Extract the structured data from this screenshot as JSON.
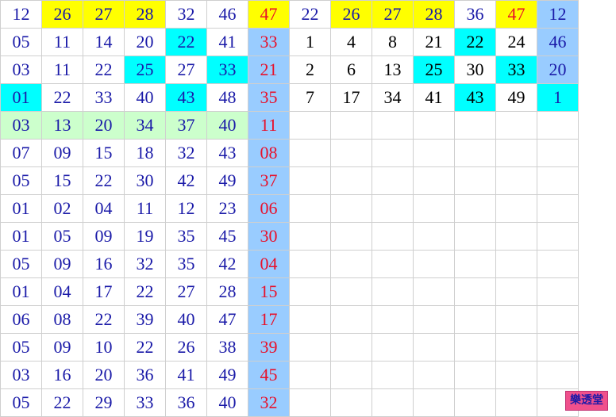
{
  "colors": {
    "yellow": "#ffff00",
    "cyan": "#00ffff",
    "light_blue": "#99ccff",
    "light_green": "#ccffcc",
    "blue_text": "#1a1aa8",
    "red_text": "#e8102a",
    "black_text": "#000000"
  },
  "left_rows": [
    {
      "cells": [
        {
          "v": "12"
        },
        {
          "v": "26",
          "bg": "yellow"
        },
        {
          "v": "27",
          "bg": "yellow"
        },
        {
          "v": "28",
          "bg": "yellow"
        },
        {
          "v": "32"
        },
        {
          "v": "46"
        },
        {
          "v": "47",
          "bg": "yellow"
        }
      ]
    },
    {
      "cells": [
        {
          "v": "05"
        },
        {
          "v": "11"
        },
        {
          "v": "14"
        },
        {
          "v": "20"
        },
        {
          "v": "22",
          "bg": "cyan"
        },
        {
          "v": "41"
        },
        {
          "v": "33"
        }
      ]
    },
    {
      "cells": [
        {
          "v": "03"
        },
        {
          "v": "11"
        },
        {
          "v": "22"
        },
        {
          "v": "25",
          "bg": "cyan"
        },
        {
          "v": "27"
        },
        {
          "v": "33",
          "bg": "cyan"
        },
        {
          "v": "21"
        }
      ]
    },
    {
      "cells": [
        {
          "v": "01",
          "bg": "cyan"
        },
        {
          "v": "22"
        },
        {
          "v": "33"
        },
        {
          "v": "40"
        },
        {
          "v": "43",
          "bg": "cyan"
        },
        {
          "v": "48"
        },
        {
          "v": "35"
        }
      ]
    },
    {
      "cells": [
        {
          "v": "03",
          "bg": "green"
        },
        {
          "v": "13",
          "bg": "green"
        },
        {
          "v": "20",
          "bg": "green"
        },
        {
          "v": "34",
          "bg": "green"
        },
        {
          "v": "37",
          "bg": "green"
        },
        {
          "v": "40",
          "bg": "green"
        },
        {
          "v": "11"
        }
      ]
    },
    {
      "cells": [
        {
          "v": "07"
        },
        {
          "v": "09"
        },
        {
          "v": "15"
        },
        {
          "v": "18"
        },
        {
          "v": "32"
        },
        {
          "v": "43"
        },
        {
          "v": "08"
        }
      ]
    },
    {
      "cells": [
        {
          "v": "05"
        },
        {
          "v": "15"
        },
        {
          "v": "22"
        },
        {
          "v": "30"
        },
        {
          "v": "42"
        },
        {
          "v": "49"
        },
        {
          "v": "37"
        }
      ]
    },
    {
      "cells": [
        {
          "v": "01"
        },
        {
          "v": "02"
        },
        {
          "v": "04"
        },
        {
          "v": "11"
        },
        {
          "v": "12"
        },
        {
          "v": "23"
        },
        {
          "v": "06"
        }
      ]
    },
    {
      "cells": [
        {
          "v": "01"
        },
        {
          "v": "05"
        },
        {
          "v": "09"
        },
        {
          "v": "19"
        },
        {
          "v": "35"
        },
        {
          "v": "45"
        },
        {
          "v": "30"
        }
      ]
    },
    {
      "cells": [
        {
          "v": "05"
        },
        {
          "v": "09"
        },
        {
          "v": "16"
        },
        {
          "v": "32"
        },
        {
          "v": "35"
        },
        {
          "v": "42"
        },
        {
          "v": "04"
        }
      ]
    },
    {
      "cells": [
        {
          "v": "01"
        },
        {
          "v": "04"
        },
        {
          "v": "17"
        },
        {
          "v": "22"
        },
        {
          "v": "27"
        },
        {
          "v": "28"
        },
        {
          "v": "15"
        }
      ]
    },
    {
      "cells": [
        {
          "v": "06"
        },
        {
          "v": "08"
        },
        {
          "v": "22"
        },
        {
          "v": "39"
        },
        {
          "v": "40"
        },
        {
          "v": "47"
        },
        {
          "v": "17"
        }
      ]
    },
    {
      "cells": [
        {
          "v": "05"
        },
        {
          "v": "09"
        },
        {
          "v": "10"
        },
        {
          "v": "22"
        },
        {
          "v": "26"
        },
        {
          "v": "38"
        },
        {
          "v": "39"
        }
      ]
    },
    {
      "cells": [
        {
          "v": "03"
        },
        {
          "v": "16"
        },
        {
          "v": "20"
        },
        {
          "v": "36"
        },
        {
          "v": "41"
        },
        {
          "v": "49"
        },
        {
          "v": "45"
        }
      ]
    },
    {
      "cells": [
        {
          "v": "05"
        },
        {
          "v": "22"
        },
        {
          "v": "29"
        },
        {
          "v": "33"
        },
        {
          "v": "36"
        },
        {
          "v": "40"
        },
        {
          "v": "32"
        }
      ]
    }
  ],
  "right_rows": [
    {
      "cells": [
        {
          "v": "22"
        },
        {
          "v": "26",
          "bg": "yellow"
        },
        {
          "v": "27",
          "bg": "yellow"
        },
        {
          "v": "28",
          "bg": "yellow"
        },
        {
          "v": "36"
        },
        {
          "v": "47",
          "bg": "yellow"
        },
        {
          "v": "12"
        }
      ]
    },
    {
      "cells": [
        {
          "v": "1"
        },
        {
          "v": "4"
        },
        {
          "v": "8"
        },
        {
          "v": "21"
        },
        {
          "v": "22",
          "bg": "cyan"
        },
        {
          "v": "24"
        },
        {
          "v": "46"
        }
      ]
    },
    {
      "cells": [
        {
          "v": "2"
        },
        {
          "v": "6"
        },
        {
          "v": "13"
        },
        {
          "v": "25",
          "bg": "cyan"
        },
        {
          "v": "30"
        },
        {
          "v": "33",
          "bg": "cyan"
        },
        {
          "v": "20"
        }
      ]
    },
    {
      "cells": [
        {
          "v": "7"
        },
        {
          "v": "17"
        },
        {
          "v": "34"
        },
        {
          "v": "41"
        },
        {
          "v": "43",
          "bg": "cyan"
        },
        {
          "v": "49"
        },
        {
          "v": "1",
          "bg": "cyan"
        }
      ]
    }
  ],
  "stamp": "樂透堂"
}
